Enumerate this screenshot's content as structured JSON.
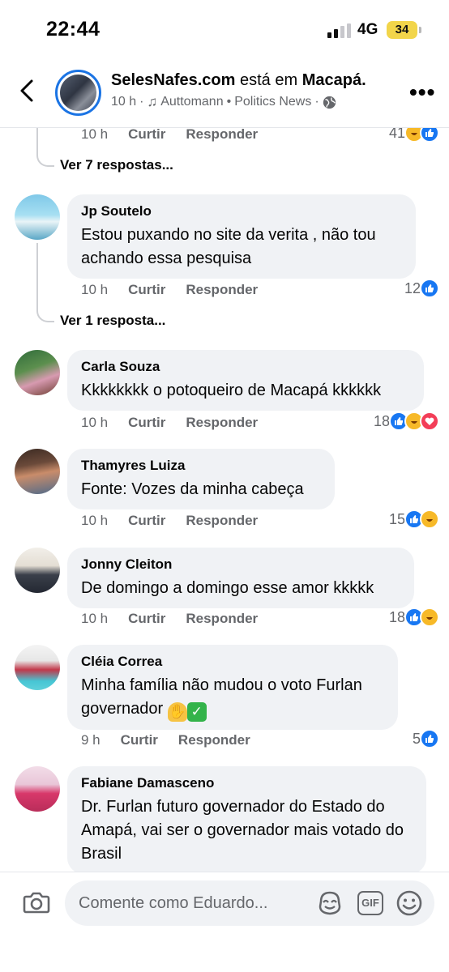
{
  "status_bar": {
    "time": "22:44",
    "network": "4G",
    "battery": "34"
  },
  "header": {
    "page_name": "SelesNafes.com",
    "location_prefix": "está em",
    "location": "Macapá.",
    "time": "10 h",
    "separator": "·",
    "music": "Auttomann",
    "music_dot": "•",
    "music_genre": "Politics News",
    "separator2": "·"
  },
  "actions": {
    "like": "Curtir",
    "reply": "Responder"
  },
  "top_partial": {
    "time": "10 h",
    "count": "41"
  },
  "replies_links": {
    "first": "Ver 7 respostas...",
    "second": "Ver 1 resposta..."
  },
  "comments": [
    {
      "author": "Jp Soutelo",
      "text": "Estou puxando no site da verita , não tou achando essa pesquisa",
      "time": "10 h",
      "count": "12",
      "reactions": [
        "like"
      ]
    },
    {
      "author": "Carla Souza",
      "text": "Kkkkkkkk o potoqueiro de Macapá kkkkkk",
      "time": "10 h",
      "count": "18",
      "reactions": [
        "like",
        "haha",
        "love"
      ]
    },
    {
      "author": "Thamyres Luiza",
      "text": "Fonte: Vozes da minha cabeça",
      "time": "10 h",
      "count": "15",
      "reactions": [
        "like",
        "haha"
      ]
    },
    {
      "author": "Jonny Cleiton",
      "text": "De domingo a domingo esse amor kkkkk",
      "time": "10 h",
      "count": "18",
      "reactions": [
        "like",
        "haha"
      ]
    },
    {
      "author": "Cléia Correa",
      "text_line1": "Minha família não mudou o voto Furlan",
      "text_line2": "governador",
      "time": "9 h",
      "count": "5",
      "reactions": [
        "like"
      ]
    },
    {
      "author": "Fabiane Damasceno",
      "text": "Dr. Furlan futuro governador do Estado do Amapá, vai ser o governador mais votado do Brasil"
    }
  ],
  "composer": {
    "placeholder": "Comente como Eduardo...",
    "gif_label": "GIF"
  },
  "colors": {
    "accent": "#1877f2",
    "bubble": "#f0f2f5",
    "secondary_text": "#65676b",
    "haha": "#f7b928",
    "love": "#f33e58"
  }
}
